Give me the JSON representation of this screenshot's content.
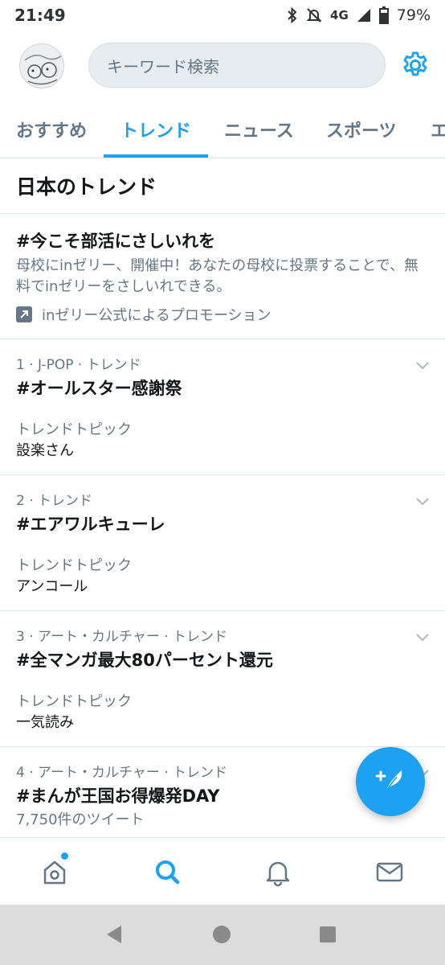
{
  "status_bar": {
    "time": "21:49",
    "network": "4G",
    "battery": "79%",
    "icons": [
      "bluetooth-icon",
      "mute-icon",
      "signal-icon",
      "battery-icon"
    ]
  },
  "search": {
    "placeholder": "キーワード検索"
  },
  "tabs": [
    {
      "label": "おすすめ",
      "active": false
    },
    {
      "label": "トレンド",
      "active": true
    },
    {
      "label": "ニュース",
      "active": false
    },
    {
      "label": "スポーツ",
      "active": false
    },
    {
      "label": "エ",
      "active": false
    }
  ],
  "section": {
    "title": "日本のトレンド"
  },
  "promo": {
    "title": "#今こそ部活にさしいれを",
    "description": "母校にinゼリー、開催中！あなたの母校に投票することで、無料でinゼリーをさしいれできる。",
    "promoted_by": "inゼリー公式によるプロモーション"
  },
  "trends": [
    {
      "meta": "1 · J-POP · トレンド",
      "title": "#オールスター感謝祭",
      "topic_label": "トレンドトピック",
      "topic": "設楽さん"
    },
    {
      "meta": "2 · トレンド",
      "title": "#エアワルキューレ",
      "topic_label": "トレンドトピック",
      "topic": "アンコール"
    },
    {
      "meta": "3 · アート・カルチャー · トレンド",
      "title": "#全マンガ最大80パーセント還元",
      "topic_label": "トレンドトピック",
      "topic": "一気読み"
    },
    {
      "meta": "4 · アート・カルチャー · トレンド",
      "title": "#まんが王国お得爆発DAY",
      "tweets": "7,750件のツイート"
    }
  ],
  "colors": {
    "accent": "#1da1f2",
    "secondary_text": "#657786",
    "primary_text": "#14171a",
    "divider": "#e1e8ed"
  },
  "bottom_nav": [
    "home-icon",
    "search-icon",
    "notifications-icon",
    "messages-icon"
  ],
  "android_nav": [
    "back-icon",
    "home-circle-icon",
    "recents-icon"
  ]
}
